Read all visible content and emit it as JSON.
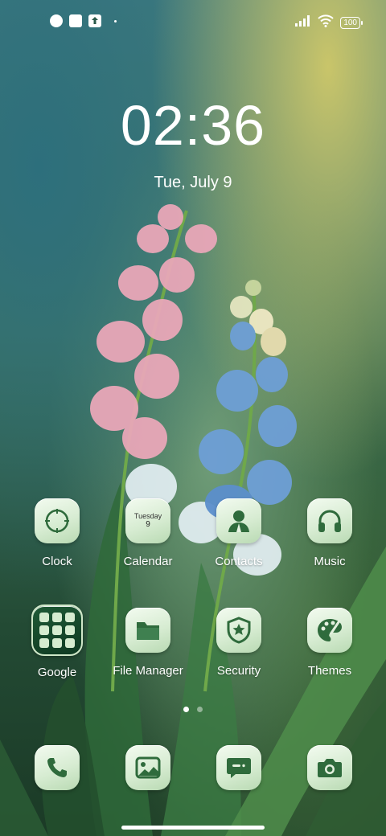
{
  "status_bar": {
    "left_icons": [
      "app-notification-icon",
      "square-notification-icon",
      "upload-icon"
    ],
    "right_icons": [
      "signal-icon",
      "wifi-icon",
      "battery-icon"
    ],
    "battery_level": "100"
  },
  "lockscreen": {
    "time": "02:36",
    "date": "Tue, July 9"
  },
  "apps_row1": [
    {
      "label": "Clock",
      "icon": "clock-icon"
    },
    {
      "label": "Calendar",
      "icon": "calendar-icon",
      "day_name": "Tuesday",
      "day_number": "9"
    },
    {
      "label": "Contacts",
      "icon": "contacts-icon"
    },
    {
      "label": "Music",
      "icon": "headphones-icon"
    }
  ],
  "apps_row2": [
    {
      "label": "Google",
      "icon": "folder-icon"
    },
    {
      "label": "File Manager",
      "icon": "file-folder-icon"
    },
    {
      "label": "Security",
      "icon": "shield-star-icon"
    },
    {
      "label": "Themes",
      "icon": "palette-icon"
    }
  ],
  "dock": [
    {
      "icon": "phone-icon"
    },
    {
      "icon": "gallery-icon"
    },
    {
      "icon": "messages-icon"
    },
    {
      "icon": "camera-icon"
    }
  ],
  "pages": {
    "count": 2,
    "active": 1
  },
  "colors": {
    "icon_glyph": "#2f6b3c",
    "icon_bg": "#dff0da"
  }
}
